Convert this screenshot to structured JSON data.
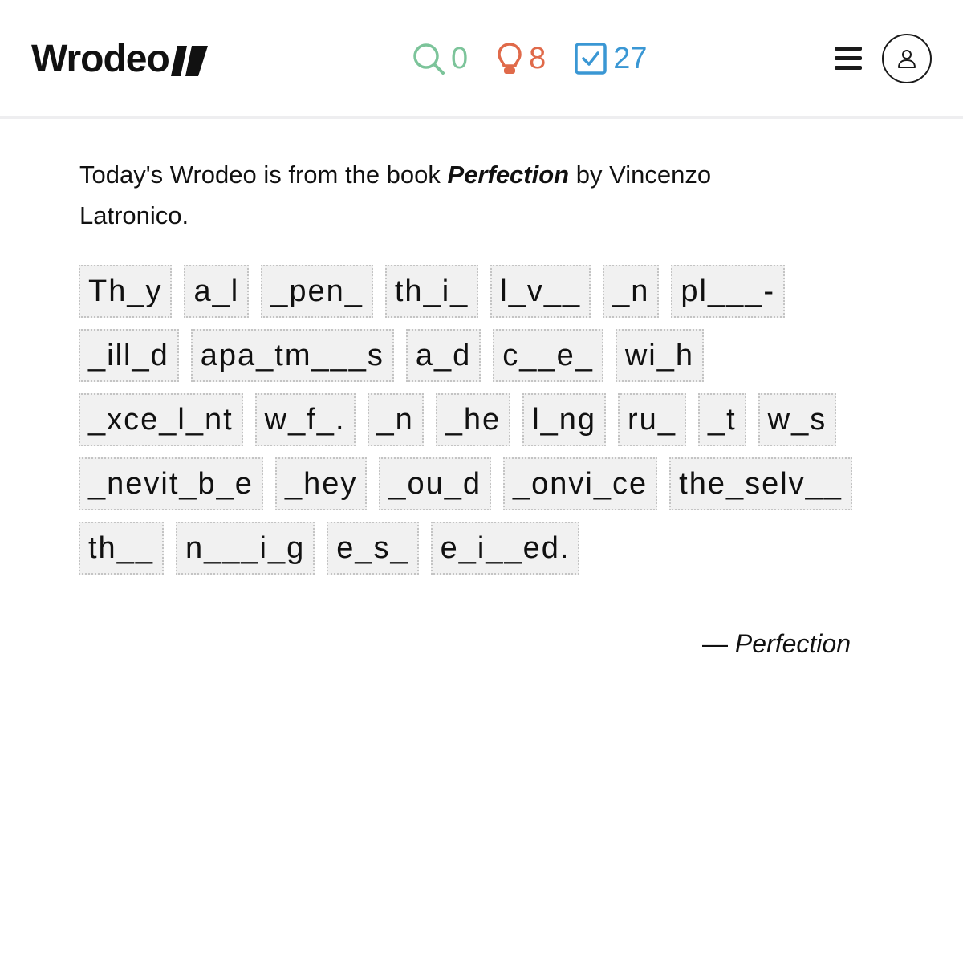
{
  "header": {
    "logo_text": "Wrodeo",
    "stats": {
      "searches": "0",
      "hints": "8",
      "solved": "27"
    },
    "icons": {
      "search": "search-icon",
      "hint": "lightbulb-icon",
      "solved": "checkbox-icon",
      "menu": "hamburger-menu-icon",
      "profile": "user-icon"
    }
  },
  "intro": {
    "prefix": "Today's Wrodeo is from the book ",
    "book": "Perfection",
    "middle": " by Vincenzo",
    "suffix": "Latronico."
  },
  "puzzle": {
    "rows": [
      [
        "Th_y",
        "a_l",
        "_pen_",
        "th_i_",
        "l_v__",
        "_n",
        "pl___-"
      ],
      [
        "_ill_d",
        "apa_tm___s",
        "a_d",
        "c__e_",
        "wi_h"
      ],
      [
        "_xce_l_nt",
        "w_f_.",
        "_n",
        "_he",
        "l_ng",
        "ru_",
        "_t",
        "w_s"
      ],
      [
        "_nevit_b_e",
        "_hey",
        "_ou_d",
        "_onvi_ce",
        "the_selv__"
      ],
      [
        "th__",
        "n___i_g",
        "e_s_",
        "e_i__ed."
      ]
    ]
  },
  "attribution": {
    "dash": "— ",
    "title": "Perfection"
  },
  "colors": {
    "search": "#7cc49a",
    "hint": "#e06a4a",
    "solved": "#3a97d4",
    "tile_bg": "#f1f1f1",
    "tile_border": "#c4c4c4"
  }
}
